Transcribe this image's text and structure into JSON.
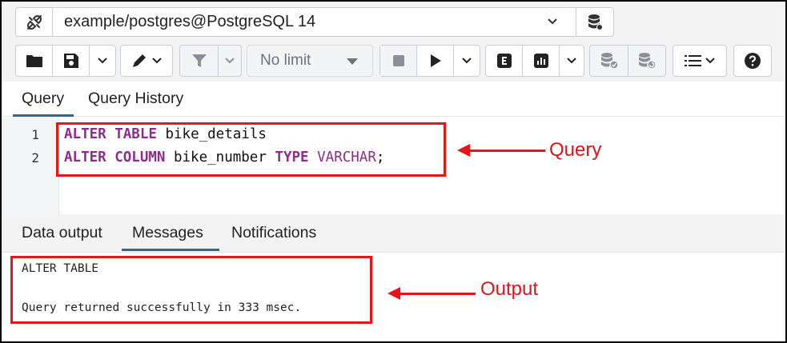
{
  "connection": {
    "label": "example/postgres@PostgreSQL 14",
    "caret": "⌄"
  },
  "toolbar": {
    "limit_value": "No limit"
  },
  "query_tabs": [
    {
      "label": "Query",
      "active": true
    },
    {
      "label": "Query History",
      "active": false
    }
  ],
  "editor": {
    "line_numbers": [
      "1",
      "2"
    ],
    "lines": [
      [
        {
          "text": "ALTER",
          "cls": "kw"
        },
        {
          "text": " ",
          "cls": ""
        },
        {
          "text": "TABLE",
          "cls": "kw"
        },
        {
          "text": " bike_details",
          "cls": ""
        }
      ],
      [
        {
          "text": "ALTER",
          "cls": "kw"
        },
        {
          "text": " ",
          "cls": ""
        },
        {
          "text": "COLUMN",
          "cls": "kw"
        },
        {
          "text": " bike_number ",
          "cls": ""
        },
        {
          "text": "TYPE",
          "cls": "kw"
        },
        {
          "text": " ",
          "cls": ""
        },
        {
          "text": "VARCHAR",
          "cls": "ty"
        },
        {
          "text": ";",
          "cls": ""
        }
      ]
    ]
  },
  "output_tabs": [
    {
      "label": "Data output",
      "active": false
    },
    {
      "label": "Messages",
      "active": true
    },
    {
      "label": "Notifications",
      "active": false
    }
  ],
  "messages": {
    "line1": "ALTER TABLE",
    "line2": "Query returned successfully in 333 msec."
  },
  "annotations": {
    "query_label": "Query",
    "output_label": "Output",
    "color": "#e8141a"
  },
  "colors": {
    "keyword": "#8e2c8b",
    "tab_underline": "#326690"
  },
  "icons": [
    "plug-icon",
    "database-icon",
    "folder-icon",
    "save-icon",
    "pen-icon",
    "filter-icon",
    "stop-icon",
    "play-icon",
    "explain-icon",
    "chart-icon",
    "commit-icon",
    "rollback-icon",
    "list-icon",
    "help-icon"
  ]
}
